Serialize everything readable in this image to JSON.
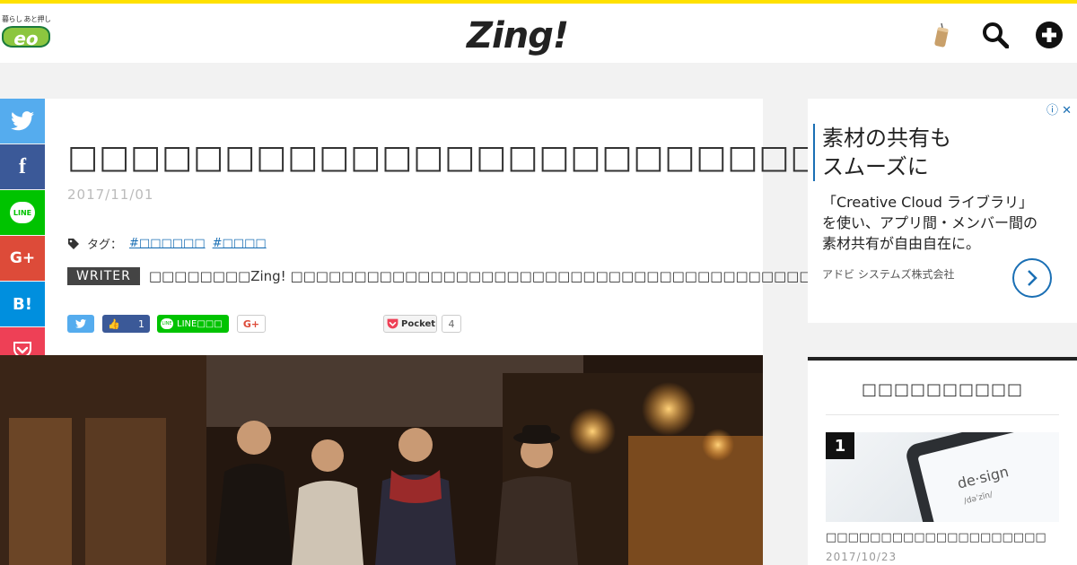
{
  "header": {
    "eo_tagline": "暮らし あと押し",
    "eo_logo": "eo",
    "site_logo": "Zing!",
    "icons": [
      "candle-icon",
      "search-icon",
      "plus-circle-icon"
    ]
  },
  "share_sidebar": [
    {
      "name": "twitter",
      "label": "",
      "icon": "twitter-bird-icon",
      "color": "#55acee"
    },
    {
      "name": "facebook",
      "label": "f",
      "icon": "facebook-icon",
      "color": "#3b5998"
    },
    {
      "name": "line",
      "label": "LINE",
      "icon": "line-icon",
      "color": "#00c300"
    },
    {
      "name": "googleplus",
      "label": "G+",
      "icon": "google-plus-icon",
      "color": "#dd4b39"
    },
    {
      "name": "hatena",
      "label": "B!",
      "icon": "hatena-icon",
      "color": "#008fde"
    },
    {
      "name": "pocket",
      "label": "",
      "icon": "pocket-icon",
      "color": "#ee4056"
    }
  ],
  "article": {
    "title": "□□□□□□□□□□□□□□□□□□□□□□□□□□□□□□",
    "date": "2017/11/01",
    "tags_label": "タグ：",
    "tags": [
      "#□□□□□□",
      "#□□□□"
    ],
    "writer_label": "WRITER",
    "writer_text": "□□□□□□□□Zing! □□□□□□□□□□□□□□□□□□□□□□□□□□□□□□□□□□□□□□□□□",
    "share_buttons": {
      "like_count": "1",
      "line_label": "LINE□□□",
      "gplus_label": "G+",
      "pocket_label": "Pocket",
      "pocket_count": "4"
    }
  },
  "ad": {
    "headline_line1": "素材の共有も",
    "headline_line2": "スムーズに",
    "body_line1": "「Creative Cloud ライブラリ」",
    "body_line2": "を使い、アプリ間・メンバー間の",
    "body_line3": "素材共有が自由自在に。",
    "advertiser": "アドビ システムズ株式会社",
    "close_label": "ⓘ ✕"
  },
  "ranking": {
    "title": "□□□□□□□□□□",
    "items": [
      {
        "rank": "1",
        "image_text": "de·sign",
        "image_subtext": "/dəˈzīn/",
        "title": "□□□□□□□□□□□□□□□□□□□□",
        "date": "2017/10/23"
      }
    ]
  },
  "colors": {
    "accent_yellow": "#ffe100",
    "link_blue": "#1a6fb4"
  }
}
